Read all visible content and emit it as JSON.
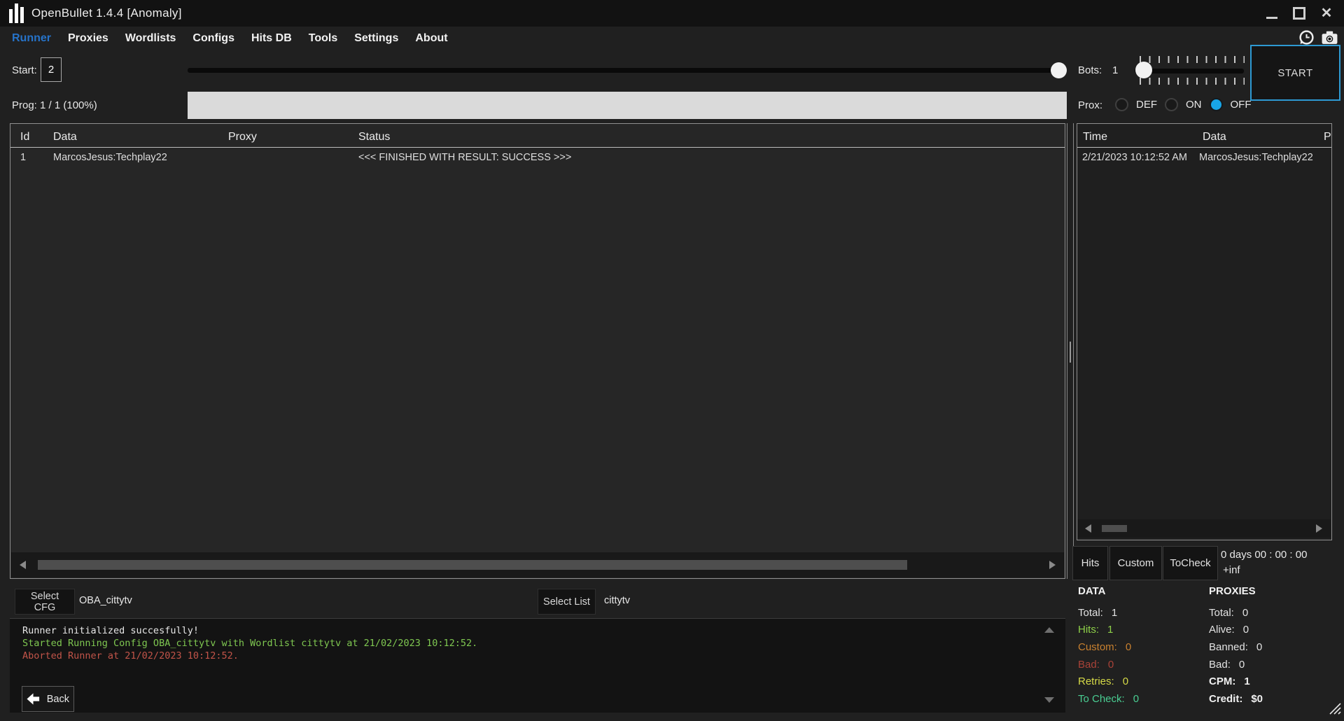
{
  "window": {
    "title": "OpenBullet 1.4.4 [Anomaly]"
  },
  "menu": {
    "items": [
      {
        "label": "Runner",
        "active": true
      },
      {
        "label": "Proxies",
        "active": false
      },
      {
        "label": "Wordlists",
        "active": false
      },
      {
        "label": "Configs",
        "active": false
      },
      {
        "label": "Hits DB",
        "active": false
      },
      {
        "label": "Tools",
        "active": false
      },
      {
        "label": "Settings",
        "active": false
      },
      {
        "label": "About",
        "active": false
      }
    ]
  },
  "controls": {
    "start_label": "Start:",
    "start_value": "2",
    "bots_label": "Bots:",
    "bots_value": "1",
    "prog_label": "Prog: 1 / 1 (100%)",
    "progress_percent": 100,
    "prox_label": "Prox:",
    "prox_options": [
      {
        "label": "DEF",
        "selected": false
      },
      {
        "label": "ON",
        "selected": false
      },
      {
        "label": "OFF",
        "selected": true
      }
    ],
    "start_button_label": "START"
  },
  "results_table": {
    "columns": [
      "Id",
      "Data",
      "Proxy",
      "Status"
    ],
    "rows": [
      {
        "id": "1",
        "data": "MarcosJesus:Techplay22",
        "proxy": "",
        "status": "<<< FINISHED WITH RESULT: SUCCESS >>>"
      }
    ]
  },
  "hits_panel": {
    "columns": [
      "Time",
      "Data",
      "Pr"
    ],
    "rows": [
      {
        "time": "2/21/2023 10:12:52 AM",
        "data": "MarcosJesus:Techplay22"
      }
    ],
    "tabs": [
      {
        "label": "Hits"
      },
      {
        "label": "Custom"
      },
      {
        "label": "ToCheck"
      }
    ],
    "elapsed": "0 days 00 : 00 : 00",
    "eta": "+inf"
  },
  "selectors": {
    "cfg_button_label": "Select CFG",
    "cfg_value": "OBA_cittytv",
    "list_button_label": "Select List",
    "list_value": "cittytv"
  },
  "log": {
    "lines": [
      {
        "text": "Runner initialized succesfully!",
        "color": "#e8e8e8"
      },
      {
        "text": "Started Running Config OBA_cittytv with Wordlist cittytv at 21/02/2023 10:12:52.",
        "color": "#7fc851"
      },
      {
        "text": "Aborted Runner at 21/02/2023 10:12:52.",
        "color": "#c25449"
      }
    ]
  },
  "back_button_label": "Back",
  "stats": {
    "data": {
      "title": "DATA",
      "rows": [
        {
          "label": "Total:",
          "value": "1",
          "color": "#e2e2e2"
        },
        {
          "label": "Hits:",
          "value": "1",
          "color": "#8ed049"
        },
        {
          "label": "Custom:",
          "value": "0",
          "color": "#c8802f"
        },
        {
          "label": "Bad:",
          "value": "0",
          "color": "#aa4238"
        },
        {
          "label": "Retries:",
          "value": "0",
          "color": "#d6da47"
        },
        {
          "label": "To Check:",
          "value": "0",
          "color": "#49cd92"
        }
      ]
    },
    "proxies": {
      "title": "PROXIES",
      "rows": [
        {
          "label": "Total:",
          "value": "0",
          "color": "#e2e2e2"
        },
        {
          "label": "Alive:",
          "value": "0",
          "color": "#e2e2e2"
        },
        {
          "label": "Banned:",
          "value": "0",
          "color": "#e2e2e2"
        },
        {
          "label": "Bad:",
          "value": "0",
          "color": "#e2e2e2"
        },
        {
          "label": "CPM:",
          "value": "1",
          "color": "#f0f0f0"
        },
        {
          "label": "Credit:",
          "value": "$0",
          "color": "#f0f0f0"
        }
      ]
    }
  },
  "colors": {
    "accent_blue": "#2e9ad3",
    "menu_active_blue": "#2673c9",
    "radio_selected_blue": "#18a6e8",
    "progress_fill": "#dadada"
  }
}
